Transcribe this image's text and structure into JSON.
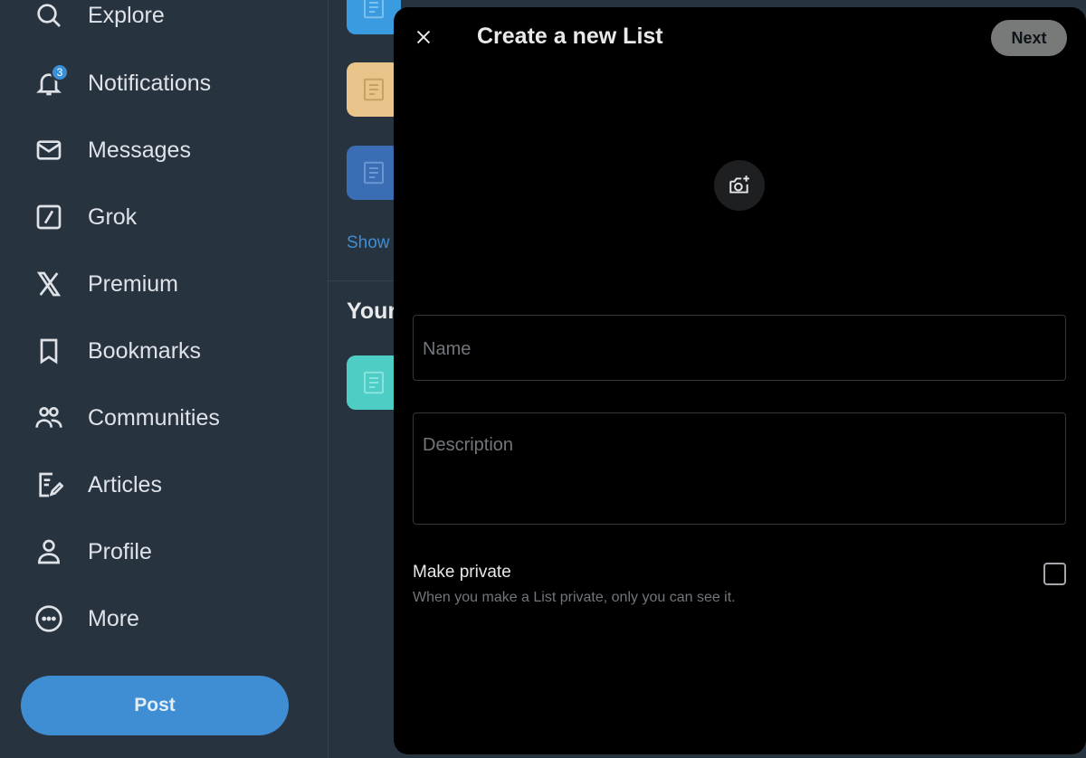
{
  "sidebar": {
    "items": [
      {
        "label": "Explore",
        "icon": "search-icon"
      },
      {
        "label": "Notifications",
        "icon": "bell-icon",
        "badge": "3"
      },
      {
        "label": "Messages",
        "icon": "envelope-icon"
      },
      {
        "label": "Grok",
        "icon": "grok-icon"
      },
      {
        "label": "Premium",
        "icon": "x-logo-icon"
      },
      {
        "label": "Bookmarks",
        "icon": "bookmark-icon"
      },
      {
        "label": "Communities",
        "icon": "people-icon"
      },
      {
        "label": "Articles",
        "icon": "article-edit-icon"
      },
      {
        "label": "Profile",
        "icon": "person-icon"
      },
      {
        "label": "More",
        "icon": "more-circle-icon"
      }
    ],
    "post_label": "Post"
  },
  "background": {
    "show_link": "Show",
    "your_title": "Your",
    "thumb_colors": [
      "#3a9be0",
      "#e8c48a",
      "#3b6db5",
      "#4ecdc4"
    ]
  },
  "modal": {
    "title": "Create a new List",
    "next_label": "Next",
    "name_placeholder": "Name",
    "description_placeholder": "Description",
    "private_label": "Make private",
    "private_description": "When you make a List private, only you can see it."
  },
  "colors": {
    "accent": "#3f8ed3",
    "background": "#283340",
    "modal": "#000000"
  }
}
